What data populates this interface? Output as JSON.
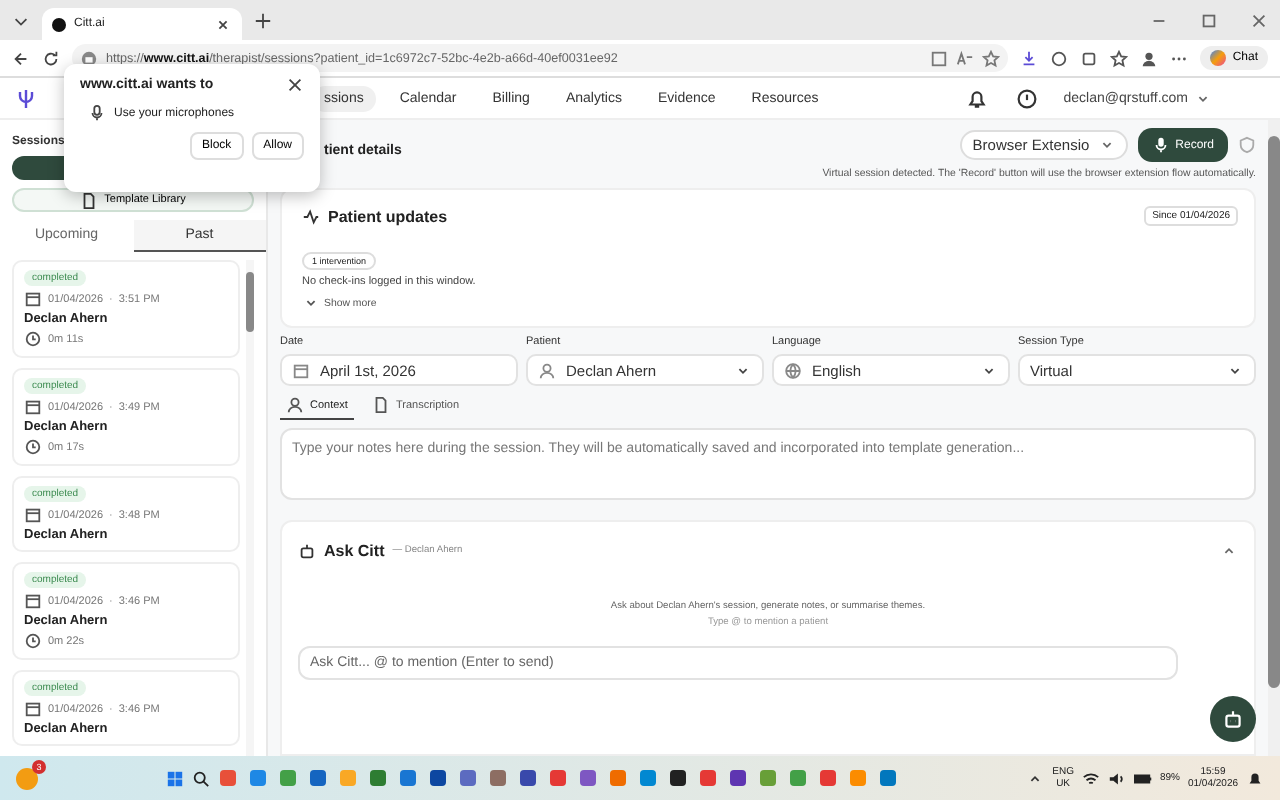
{
  "browser": {
    "tab_title": "Citt.ai",
    "url": "https://**www.citt.ai**/therapist/sessions?patient_id=1c6972c7-52bc-4e2b-a66d-40ef0031ee92",
    "chat_label": "Chat"
  },
  "permission_popup": {
    "title": "www.citt.ai wants to",
    "permission": "Use your microphones",
    "buttons": [
      "Block",
      "Allow"
    ]
  },
  "nav": {
    "items": [
      {
        "label": "ssions",
        "selected": true
      },
      {
        "label": "Calendar",
        "selected": false
      },
      {
        "label": "Billing",
        "selected": false
      },
      {
        "label": "Analytics",
        "selected": false
      },
      {
        "label": "Evidence",
        "selected": false
      },
      {
        "label": "Resources",
        "selected": false
      }
    ],
    "account": "declan@qrstuff.com"
  },
  "sidebar": {
    "heading": "Sessions",
    "template_button": "Template Library",
    "tabs": [
      {
        "label": "Upcoming",
        "selected": false
      },
      {
        "label": "Past",
        "selected": true
      }
    ],
    "sessions": [
      {
        "status": "completed",
        "date": "01/04/2026",
        "separator": "·",
        "time": "3:51 PM",
        "name": "Declan Ahern",
        "duration": "0m 11s"
      },
      {
        "status": "completed",
        "date": "01/04/2026",
        "separator": "·",
        "time": "3:49 PM",
        "name": "Declan Ahern",
        "duration": "0m 17s"
      },
      {
        "status": "completed",
        "date": "01/04/2026",
        "separator": "·",
        "time": "3:48 PM",
        "name": "Declan Ahern"
      },
      {
        "status": "completed",
        "date": "01/04/2026",
        "separator": "·",
        "time": "3:46 PM",
        "name": "Declan Ahern",
        "duration": "0m 22s"
      },
      {
        "status": "completed",
        "date": "01/04/2026",
        "separator": "·",
        "time": "3:46 PM",
        "name": "Declan Ahern"
      }
    ]
  },
  "main": {
    "title": "tient details",
    "capture_mode": "Browser Extensio",
    "record_label": "Record",
    "hint": "Virtual session detected. The 'Record' button will use the browser extension flow automatically.",
    "patient_updates": {
      "title": "Patient updates",
      "since": "Since 01/04/2026",
      "pill": "1 intervention",
      "message": "No check-ins logged in this window.",
      "show_more": "Show more"
    },
    "form": [
      {
        "kind": "date",
        "label": "Date",
        "value": "April 1st, 2026"
      },
      {
        "kind": "person",
        "label": "Patient",
        "value": "Declan Ahern"
      },
      {
        "kind": "language",
        "label": "Language",
        "value": "English"
      },
      {
        "kind": "plain",
        "label": "Session Type",
        "value": "Virtual"
      }
    ],
    "note_tabs": [
      {
        "label": "Context",
        "selected": true
      },
      {
        "label": "Transcription",
        "selected": false
      }
    ],
    "notes_placeholder": "Type your notes here during the session. They will be automatically saved and incorporated into template generation...",
    "ask": {
      "title": "Ask Citt",
      "subtitle": "— Declan Ahern",
      "expanded": true,
      "prompt": "Ask about Declan Ahern's session, generate notes, or summarise themes.",
      "tip": "Type @ to mention a patient",
      "placeholder": "Ask Citt... @ to mention (Enter to send)"
    }
  },
  "taskbar": {
    "badge": "3",
    "lang": "ENG",
    "region": "UK",
    "battery": "89%",
    "time": "15:59",
    "date": "01/04/2026"
  }
}
